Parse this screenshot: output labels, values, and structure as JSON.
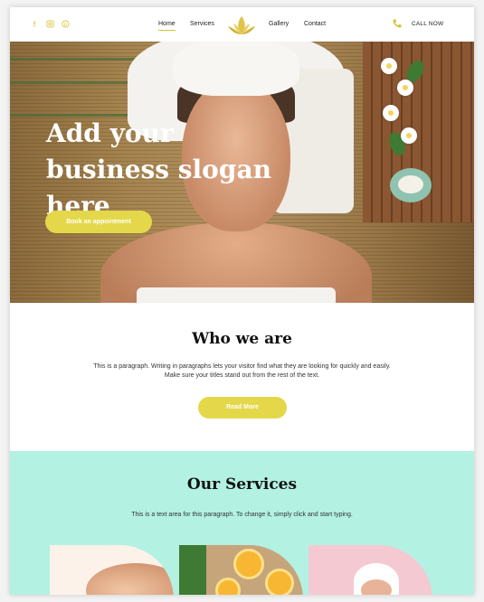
{
  "nav": {
    "items": [
      "Home",
      "Services",
      "Gallery",
      "Contact"
    ],
    "active": "Home",
    "call_now": "CALL NOW"
  },
  "social_icons": [
    "facebook-icon",
    "instagram-icon",
    "pinterest-icon"
  ],
  "hero": {
    "slogan": "Add your business slogan here",
    "cta": "Book an appointment"
  },
  "who": {
    "title": "Who we are",
    "paragraph_line1": "This is a paragraph. Writing in paragraphs lets your visitor find what they are looking for quickly and easily.",
    "paragraph_line2": "Make sure your titles stand out from the rest of the text.",
    "button": "Read More"
  },
  "services": {
    "title": "Our Services",
    "paragraph": "This is a text area for this paragraph. To change it, simply click and start typing."
  },
  "colors": {
    "accent": "#e4d84a",
    "gold": "#d9c23a",
    "services_bg": "#b3f1e3"
  }
}
